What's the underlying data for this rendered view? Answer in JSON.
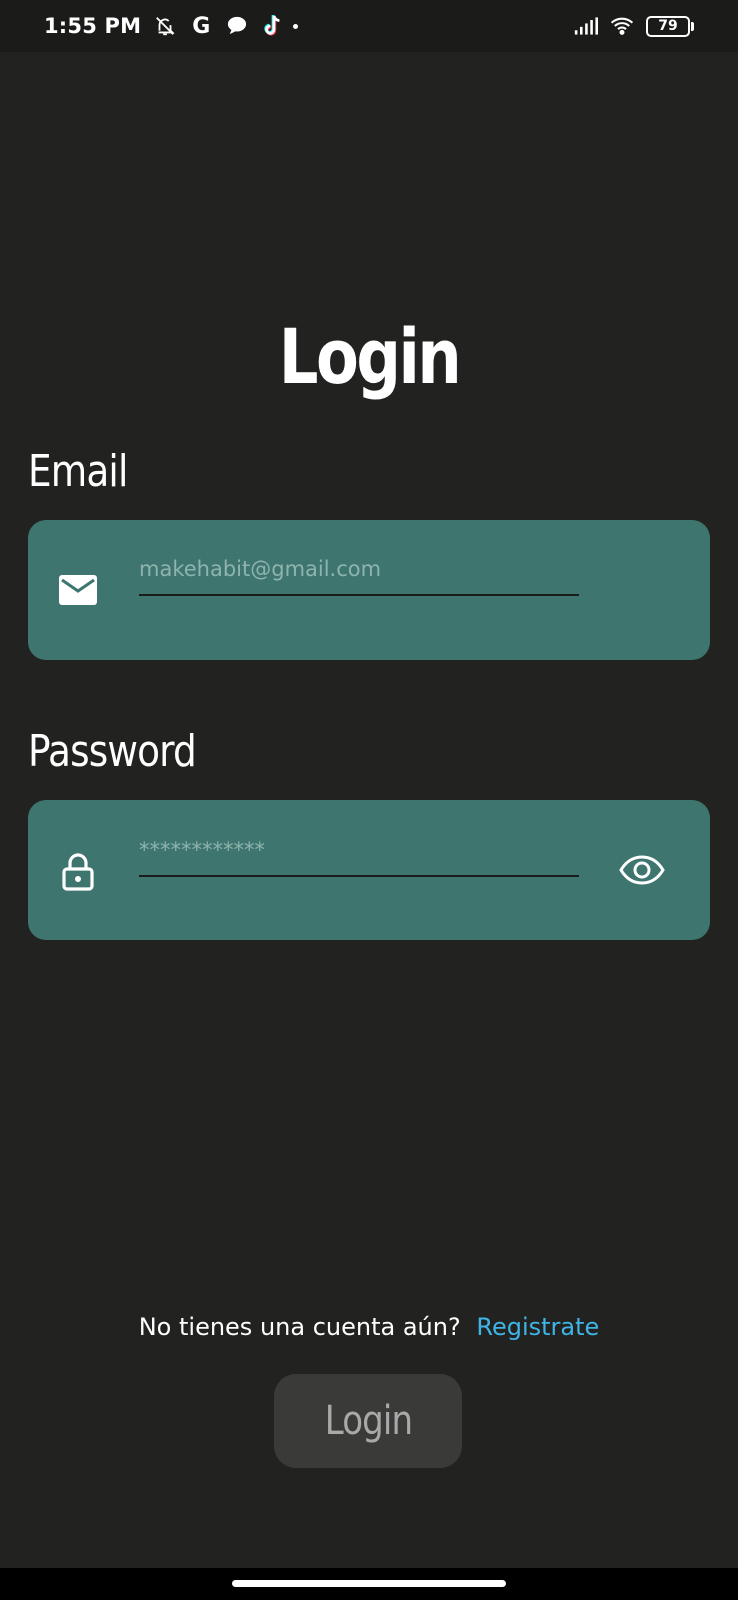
{
  "status_bar": {
    "time": "1:55 PM",
    "google_letter": "G",
    "battery_level": "79",
    "icons": [
      "bell-off-icon",
      "google-icon",
      "chat-bubble-icon",
      "tiktok-icon",
      "dot-icon",
      "signal-icon",
      "wifi-icon",
      "battery-icon"
    ]
  },
  "login": {
    "title": "Login",
    "email_label": "Email",
    "email_placeholder": "makehabit@gmail.com",
    "password_label": "Password",
    "password_placeholder": "************",
    "signup_prompt": "No tienes una cuenta aún?",
    "signup_link": "Registrate",
    "login_button": "Login"
  },
  "colors": {
    "background": "#222321",
    "input_card": "#3e766f",
    "link": "#3fb4e6",
    "button": "#3a3a39"
  }
}
